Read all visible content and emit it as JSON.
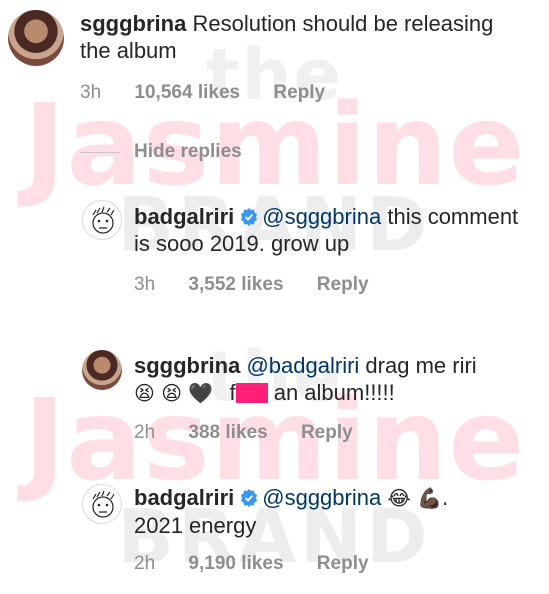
{
  "watermark": {
    "the": "the",
    "jasmine": "Jasmine",
    "brand": "BRAND"
  },
  "comments": [
    {
      "username": "sgggbrina",
      "text": "Resolution should be releasing the album",
      "time": "3h",
      "likes": "10,564 likes",
      "reply": "Reply"
    }
  ],
  "hide_replies": "Hide replies",
  "replies": [
    {
      "username": "badgalriri",
      "mention": "@sgggbrina",
      "text": "this comment is sooo 2019. grow up",
      "time": "3h",
      "likes": "3,552 likes",
      "reply": "Reply"
    },
    {
      "username": "sgggbrina",
      "mention": "@badgalriri",
      "text_before": "drag me riri",
      "emojis": "😫 😫 🖤",
      "text_f": "f",
      "text_after": "an album!!!!!",
      "time": "2h",
      "likes": "388 likes",
      "reply": "Reply"
    },
    {
      "username": "badgalriri",
      "mention": "@sgggbrina",
      "emojis": "😂 💪🏿.",
      "text_line2": "2021 energy",
      "time": "2h",
      "likes": "9,190 likes",
      "reply": "Reply"
    }
  ],
  "colors": {
    "text": "#262626",
    "meta": "#8e8e8e",
    "mention": "#00376b",
    "verified": "#3897f0",
    "censor": "#ff1f7a"
  }
}
